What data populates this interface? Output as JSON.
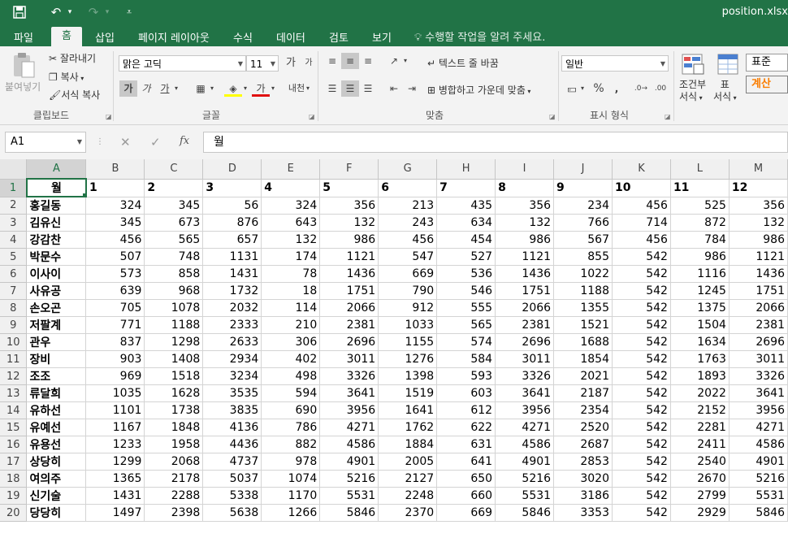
{
  "titlebar": {
    "filename": "position.xlsx",
    "save_icon": "save-icon",
    "undo_icon": "undo-icon",
    "redo_icon": "redo-icon",
    "qat_icon": "customize-qat-icon"
  },
  "tabs": [
    "파일",
    "홈",
    "삽입",
    "페이지 레이아웃",
    "수식",
    "데이터",
    "검토",
    "보기"
  ],
  "tell_me": "수행할 작업을 알려 주세요.",
  "ribbon": {
    "clipboard": {
      "paste": "붙여넣기",
      "cut": "잘라내기",
      "copy": "복사",
      "format_painter": "서식 복사",
      "label": "클립보드"
    },
    "font": {
      "name": "맑은 고딕",
      "size": "11",
      "label": "글꼴",
      "bold": "가",
      "italic": "가",
      "underline": "가",
      "grow": "가",
      "shrink": "가",
      "font_color": "가",
      "phonetic": "내천"
    },
    "align": {
      "wrap": "텍스트 줄 바꿈",
      "merge": "병합하고 가운데 맞춤",
      "label": "맞춤"
    },
    "number": {
      "format": "일반",
      "label": "표시 형식",
      "percent": "%"
    },
    "styles": {
      "conditional_1": "조건부",
      "conditional_2": "서식",
      "table_1": "표",
      "table_2": "서식",
      "style_normal": "표준",
      "style_calc": "계산"
    }
  },
  "formula_bar": {
    "name_box": "A1",
    "fx": "fx",
    "value": "월"
  },
  "columns": [
    "A",
    "B",
    "C",
    "D",
    "E",
    "F",
    "G",
    "H",
    "I",
    "J",
    "K",
    "L",
    "M"
  ],
  "header_row": [
    "월",
    "1",
    "2",
    "3",
    "4",
    "5",
    "6",
    "7",
    "8",
    "9",
    "10",
    "11",
    "12"
  ],
  "rows": [
    {
      "n": "2",
      "name": "홍길동",
      "v": [
        "324",
        "345",
        "56",
        "324",
        "356",
        "213",
        "435",
        "356",
        "234",
        "456",
        "525",
        "356"
      ]
    },
    {
      "n": "3",
      "name": "김유신",
      "v": [
        "345",
        "673",
        "876",
        "643",
        "132",
        "243",
        "634",
        "132",
        "766",
        "714",
        "872",
        "132"
      ]
    },
    {
      "n": "4",
      "name": "강감찬",
      "v": [
        "456",
        "565",
        "657",
        "132",
        "986",
        "456",
        "454",
        "986",
        "567",
        "456",
        "784",
        "986"
      ]
    },
    {
      "n": "5",
      "name": "박문수",
      "v": [
        "507",
        "748",
        "1131",
        "174",
        "1121",
        "547",
        "527",
        "1121",
        "855",
        "542",
        "986",
        "1121"
      ]
    },
    {
      "n": "6",
      "name": "이사이",
      "v": [
        "573",
        "858",
        "1431",
        "78",
        "1436",
        "669",
        "536",
        "1436",
        "1022",
        "542",
        "1116",
        "1436"
      ]
    },
    {
      "n": "7",
      "name": "사유공",
      "v": [
        "639",
        "968",
        "1732",
        "18",
        "1751",
        "790",
        "546",
        "1751",
        "1188",
        "542",
        "1245",
        "1751"
      ]
    },
    {
      "n": "8",
      "name": "손오곤",
      "v": [
        "705",
        "1078",
        "2032",
        "114",
        "2066",
        "912",
        "555",
        "2066",
        "1355",
        "542",
        "1375",
        "2066"
      ]
    },
    {
      "n": "9",
      "name": "저팔계",
      "v": [
        "771",
        "1188",
        "2333",
        "210",
        "2381",
        "1033",
        "565",
        "2381",
        "1521",
        "542",
        "1504",
        "2381"
      ]
    },
    {
      "n": "10",
      "name": "관우",
      "v": [
        "837",
        "1298",
        "2633",
        "306",
        "2696",
        "1155",
        "574",
        "2696",
        "1688",
        "542",
        "1634",
        "2696"
      ]
    },
    {
      "n": "11",
      "name": "장비",
      "v": [
        "903",
        "1408",
        "2934",
        "402",
        "3011",
        "1276",
        "584",
        "3011",
        "1854",
        "542",
        "1763",
        "3011"
      ]
    },
    {
      "n": "12",
      "name": "조조",
      "v": [
        "969",
        "1518",
        "3234",
        "498",
        "3326",
        "1398",
        "593",
        "3326",
        "2021",
        "542",
        "1893",
        "3326"
      ]
    },
    {
      "n": "13",
      "name": "류달희",
      "v": [
        "1035",
        "1628",
        "3535",
        "594",
        "3641",
        "1519",
        "603",
        "3641",
        "2187",
        "542",
        "2022",
        "3641"
      ]
    },
    {
      "n": "14",
      "name": "유하선",
      "v": [
        "1101",
        "1738",
        "3835",
        "690",
        "3956",
        "1641",
        "612",
        "3956",
        "2354",
        "542",
        "2152",
        "3956"
      ]
    },
    {
      "n": "15",
      "name": "유예선",
      "v": [
        "1167",
        "1848",
        "4136",
        "786",
        "4271",
        "1762",
        "622",
        "4271",
        "2520",
        "542",
        "2281",
        "4271"
      ]
    },
    {
      "n": "16",
      "name": "유용선",
      "v": [
        "1233",
        "1958",
        "4436",
        "882",
        "4586",
        "1884",
        "631",
        "4586",
        "2687",
        "542",
        "2411",
        "4586"
      ]
    },
    {
      "n": "17",
      "name": "상당히",
      "v": [
        "1299",
        "2068",
        "4737",
        "978",
        "4901",
        "2005",
        "641",
        "4901",
        "2853",
        "542",
        "2540",
        "4901"
      ]
    },
    {
      "n": "18",
      "name": "여의주",
      "v": [
        "1365",
        "2178",
        "5037",
        "1074",
        "5216",
        "2127",
        "650",
        "5216",
        "3020",
        "542",
        "2670",
        "5216"
      ]
    },
    {
      "n": "19",
      "name": "신기술",
      "v": [
        "1431",
        "2288",
        "5338",
        "1170",
        "5531",
        "2248",
        "660",
        "5531",
        "3186",
        "542",
        "2799",
        "5531"
      ]
    },
    {
      "n": "20",
      "name": "당당히",
      "v": [
        "1497",
        "2398",
        "5638",
        "1266",
        "5846",
        "2370",
        "669",
        "5846",
        "3353",
        "542",
        "2929",
        "5846"
      ]
    }
  ],
  "colors": {
    "accent": "#217346",
    "ribbon_bg": "#f3f3f3",
    "grid_line": "#d4d4d4"
  }
}
